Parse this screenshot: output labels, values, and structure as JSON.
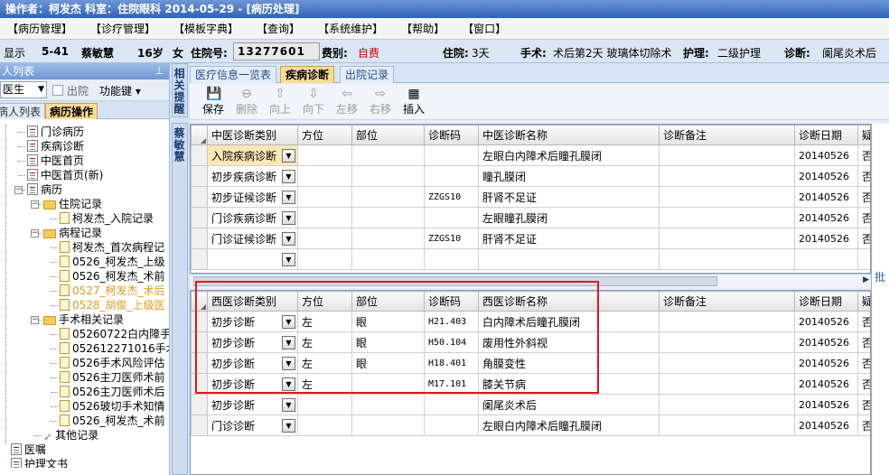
{
  "title": "操作者：柯发杰  科室：住院眼科  2014-05-29 - [病历处理]",
  "menu": [
    "【病历管理】",
    "【诊疗管理】",
    "【模板字典】",
    "【查询】",
    "【系统维护】",
    "【帮助】",
    "【窗口】"
  ],
  "patient": {
    "display": "显示",
    "bed": "5-41",
    "name": "蔡敏慧",
    "age": "16岁",
    "sex": "女",
    "inpatient_no_label": "住院号:",
    "inpatient_no": "13277601",
    "fee_label": "费别:",
    "fee_value": "自费",
    "stay_label": "住院:",
    "stay_value": "3天",
    "surgery_label": "手术:",
    "surgery_value": "术后第2天 玻璃体切除术",
    "nursing_label": "护理:",
    "nursing_value": "二级护理",
    "diag_label": "诊断:",
    "diag_value": "阑尾炎术后"
  },
  "left": {
    "header": "人列表",
    "doctor_combo": "医生",
    "discharged_label": "出院",
    "function_key_label": "功能键",
    "tabs": [
      "病人列表",
      "病历操作"
    ],
    "tree": [
      {
        "label": "门诊病历",
        "icon": "doc"
      },
      {
        "label": "疾病诊断",
        "icon": "doc"
      },
      {
        "label": "中医首页",
        "icon": "doc"
      },
      {
        "label": "中医首页(新)",
        "icon": "doc"
      },
      {
        "label": "病历",
        "icon": "doc"
      },
      {
        "label": "住院记录",
        "icon": "folder"
      },
      {
        "label": "柯发杰_入院记录",
        "icon": "note"
      },
      {
        "label": "病程记录",
        "icon": "folder"
      },
      {
        "label": "柯发杰_首次病程记",
        "icon": "note"
      },
      {
        "label": "0526_柯发杰_上级",
        "icon": "note"
      },
      {
        "label": "0526_柯发杰_术前",
        "icon": "note"
      },
      {
        "label": "0527_柯发杰_术后",
        "icon": "note"
      },
      {
        "label": "0528_胡俊_上级医",
        "icon": "note"
      },
      {
        "label": "手术相关记录",
        "icon": "folder"
      },
      {
        "label": "05260722白内障手",
        "icon": "note"
      },
      {
        "label": "052612271016手术",
        "icon": "note"
      },
      {
        "label": "0526手术风险评估",
        "icon": "note"
      },
      {
        "label": "0526主刀医师术前",
        "icon": "note"
      },
      {
        "label": "0526主刀医师术后",
        "icon": "note"
      },
      {
        "label": "0526玻切手术知情",
        "icon": "note"
      },
      {
        "label": "0526_柯发杰_术前",
        "icon": "note"
      },
      {
        "label": "其他记录",
        "icon": "check"
      },
      {
        "label": "医嘱",
        "icon": "doc"
      },
      {
        "label": "护理文书",
        "icon": "doc"
      }
    ]
  },
  "side_strips": {
    "related": "相关提醒",
    "patient": "蔡敏慧"
  },
  "tabs": [
    "医疗信息一览表",
    "疾病诊断",
    "出院记录"
  ],
  "toolbar": [
    {
      "label": "保存",
      "icon": "save-icon",
      "glyph": "💾",
      "enabled": true
    },
    {
      "label": "删除",
      "icon": "delete-icon",
      "glyph": "⊖",
      "enabled": false
    },
    {
      "label": "向上",
      "icon": "arrow-up-icon",
      "glyph": "⇧",
      "enabled": false
    },
    {
      "label": "向下",
      "icon": "arrow-down-icon",
      "glyph": "⇩",
      "enabled": false
    },
    {
      "label": "左移",
      "icon": "arrow-left-icon",
      "glyph": "⇦",
      "enabled": false
    },
    {
      "label": "右移",
      "icon": "arrow-right-icon",
      "glyph": "⇨",
      "enabled": false
    },
    {
      "label": "插入",
      "icon": "insert-icon",
      "glyph": "▦",
      "enabled": true
    }
  ],
  "tcm_grid": {
    "headers": [
      "中医诊断类别",
      "方位",
      "部位",
      "诊断码",
      "中医诊断名称",
      "诊断备注",
      "诊断日期",
      "疑"
    ],
    "rows": [
      [
        "入院疾病诊断",
        "",
        "",
        "",
        "左眼白内障术后瞳孔膜闭",
        "",
        "20140526",
        "否"
      ],
      [
        "初步疾病诊断",
        "",
        "",
        "",
        "瞳孔膜闭",
        "",
        "20140526",
        "否"
      ],
      [
        "初步证候诊断",
        "",
        "",
        "ZZGS10",
        "肝肾不足证",
        "",
        "20140526",
        "否"
      ],
      [
        "门诊疾病诊断",
        "",
        "",
        "",
        "左眼瞳孔膜闭",
        "",
        "20140526",
        "否"
      ],
      [
        "门诊证候诊断",
        "",
        "",
        "ZZGS10",
        "肝肾不足证",
        "",
        "20140526",
        "否"
      ],
      [
        "",
        "",
        "",
        "",
        "",
        "",
        "",
        ""
      ]
    ]
  },
  "western_grid": {
    "headers": [
      "西医诊断类别",
      "方位",
      "部位",
      "诊断码",
      "西医诊断名称",
      "诊断备注",
      "诊断日期",
      "疑"
    ],
    "rows": [
      [
        "初步诊断",
        "左",
        "眼",
        "H21.403",
        "白内障术后瞳孔膜闭",
        "",
        "20140526",
        "否"
      ],
      [
        "初步诊断",
        "左",
        "眼",
        "H50.104",
        "废用性外斜视",
        "",
        "20140526",
        "否"
      ],
      [
        "初步诊断",
        "左",
        "眼",
        "H18.401",
        "角膜变性",
        "",
        "20140526",
        "否"
      ],
      [
        "初步诊断",
        "左",
        "",
        "M17.101",
        "膝关节病",
        "",
        "20140526",
        "否"
      ],
      [
        "初步诊断",
        "",
        "",
        "",
        "阑尾炎术后",
        "",
        "20140526",
        "否"
      ],
      [
        "门诊诊断",
        "",
        "",
        "",
        "左眼白内障术后瞳孔膜闭",
        "",
        "20140526",
        "否"
      ]
    ]
  },
  "right_label": "批"
}
